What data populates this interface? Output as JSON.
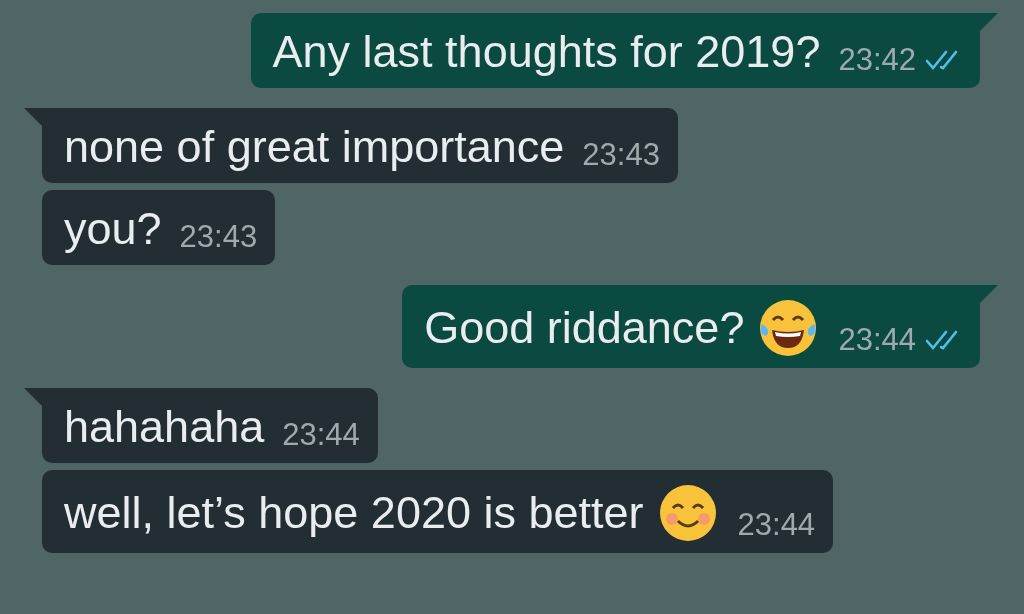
{
  "messages": [
    {
      "kind": "outgoing",
      "tail": true,
      "text": "Any last thoughts for 2019?",
      "time": "23:42",
      "read": true
    },
    {
      "kind": "incoming",
      "tail": true,
      "text": "none of great importance",
      "time": "23:43"
    },
    {
      "kind": "incoming",
      "tail": false,
      "text": "you?",
      "time": "23:43"
    },
    {
      "kind": "outgoing",
      "tail": true,
      "text": "Good riddance?",
      "emoji": {
        "kind": "laughing"
      },
      "time": "23:44",
      "read": true
    },
    {
      "kind": "incoming",
      "tail": true,
      "text": "hahahaha",
      "time": "23:44"
    },
    {
      "kind": "incoming",
      "tail": false,
      "text": "well, let’s hope 2020 is better",
      "emoji": {
        "kind": "smiling"
      },
      "time": "23:44"
    }
  ]
}
